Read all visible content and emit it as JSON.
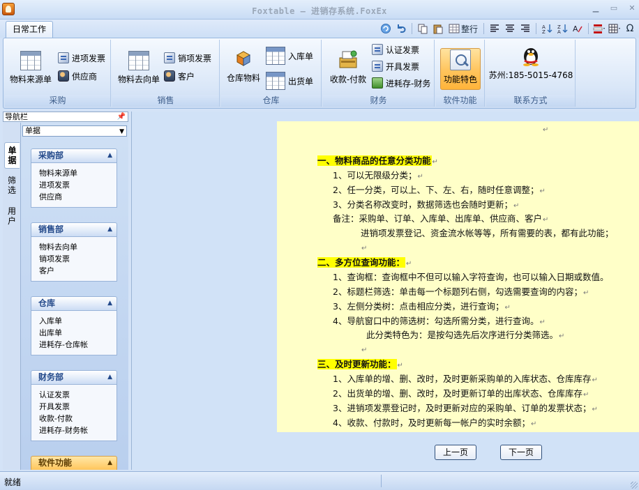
{
  "window": {
    "title": "Foxtable — 进销存系统.FoxEx"
  },
  "ribbon_tab": "日常工作",
  "quick_toolbar": {
    "arrange_label": "整行"
  },
  "groups": {
    "purchase": {
      "label": "采购",
      "big": "物料来源单",
      "small": [
        "进项发票",
        "供应商"
      ]
    },
    "sales": {
      "label": "销售",
      "big": "物料去向单",
      "small": [
        "销项发票",
        "客户"
      ]
    },
    "warehouse": {
      "label": "仓库",
      "big": "仓库物料",
      "small": [
        "入库单",
        "出货单"
      ]
    },
    "finance": {
      "label": "财务",
      "big": "收款-付款",
      "small": [
        "认证发票",
        "开具发票",
        "进耗存-财务"
      ]
    },
    "software": {
      "label": "软件功能",
      "big": "功能特色"
    },
    "contact": {
      "label": "联系方式",
      "big": "苏州:185-5015-4768"
    }
  },
  "nav": {
    "header": "导航栏",
    "vertical_tabs": [
      "单据",
      "筛选",
      "用户"
    ],
    "select_value": "单据",
    "panels": [
      {
        "title": "采购部",
        "items": [
          "物料来源单",
          "进项发票",
          "供应商"
        ]
      },
      {
        "title": "销售部",
        "items": [
          "物料去向单",
          "销项发票",
          "客户"
        ]
      },
      {
        "title": "仓库",
        "items": [
          "入库单",
          "出库单",
          "进耗存-仓库帐"
        ]
      },
      {
        "title": "财务部",
        "items": [
          "认证发票",
          "开具发票",
          "收款-付款",
          "进耗存-财务帐"
        ]
      },
      {
        "title": "软件功能",
        "items": []
      }
    ]
  },
  "document": {
    "lines": [
      "",
      "一、物料商品的任意分类功能",
      "1、可以无限级分类；",
      "2、任一分类，可以上、下、左、右，随时任意调整；",
      "3、分类名称改变时，数据筛选也会随时更新；",
      "备注：采购单、订单、入库单、出库单、供应商、客户",
      "进销项发票登记、资金流水帐等等，所有需要的表，都有此功能；",
      "",
      "二、多方位查询功能：",
      "1、查询框：查询框中不但可以输入字符查询，也可以输入日期或数值。",
      "2、标题栏筛选：单击每一个标题列右侧，勾选需要查询的内容；",
      "3、左侧分类树：点击相应分类，进行查询；",
      "4、导航窗口中的筛选树：勾选所需分类，进行查询。",
      "此分类特色为：是按勾选先后次序进行分类筛选。",
      "",
      "三、及时更新功能：",
      "1、入库单的增、删、改时，及时更新采购单的入库状态、仓库库存",
      "2、出货单的增、删、改时，及时更新订单的出库状态、仓库库存",
      "3、进销项发票登记时，及时更新对应的采购单、订单的发票状态；",
      "4、收款、付款时，及时更新每一帐户的实时余额；"
    ],
    "prev_button": "上一页",
    "next_button": "下一页"
  },
  "status": {
    "text": "就绪"
  }
}
